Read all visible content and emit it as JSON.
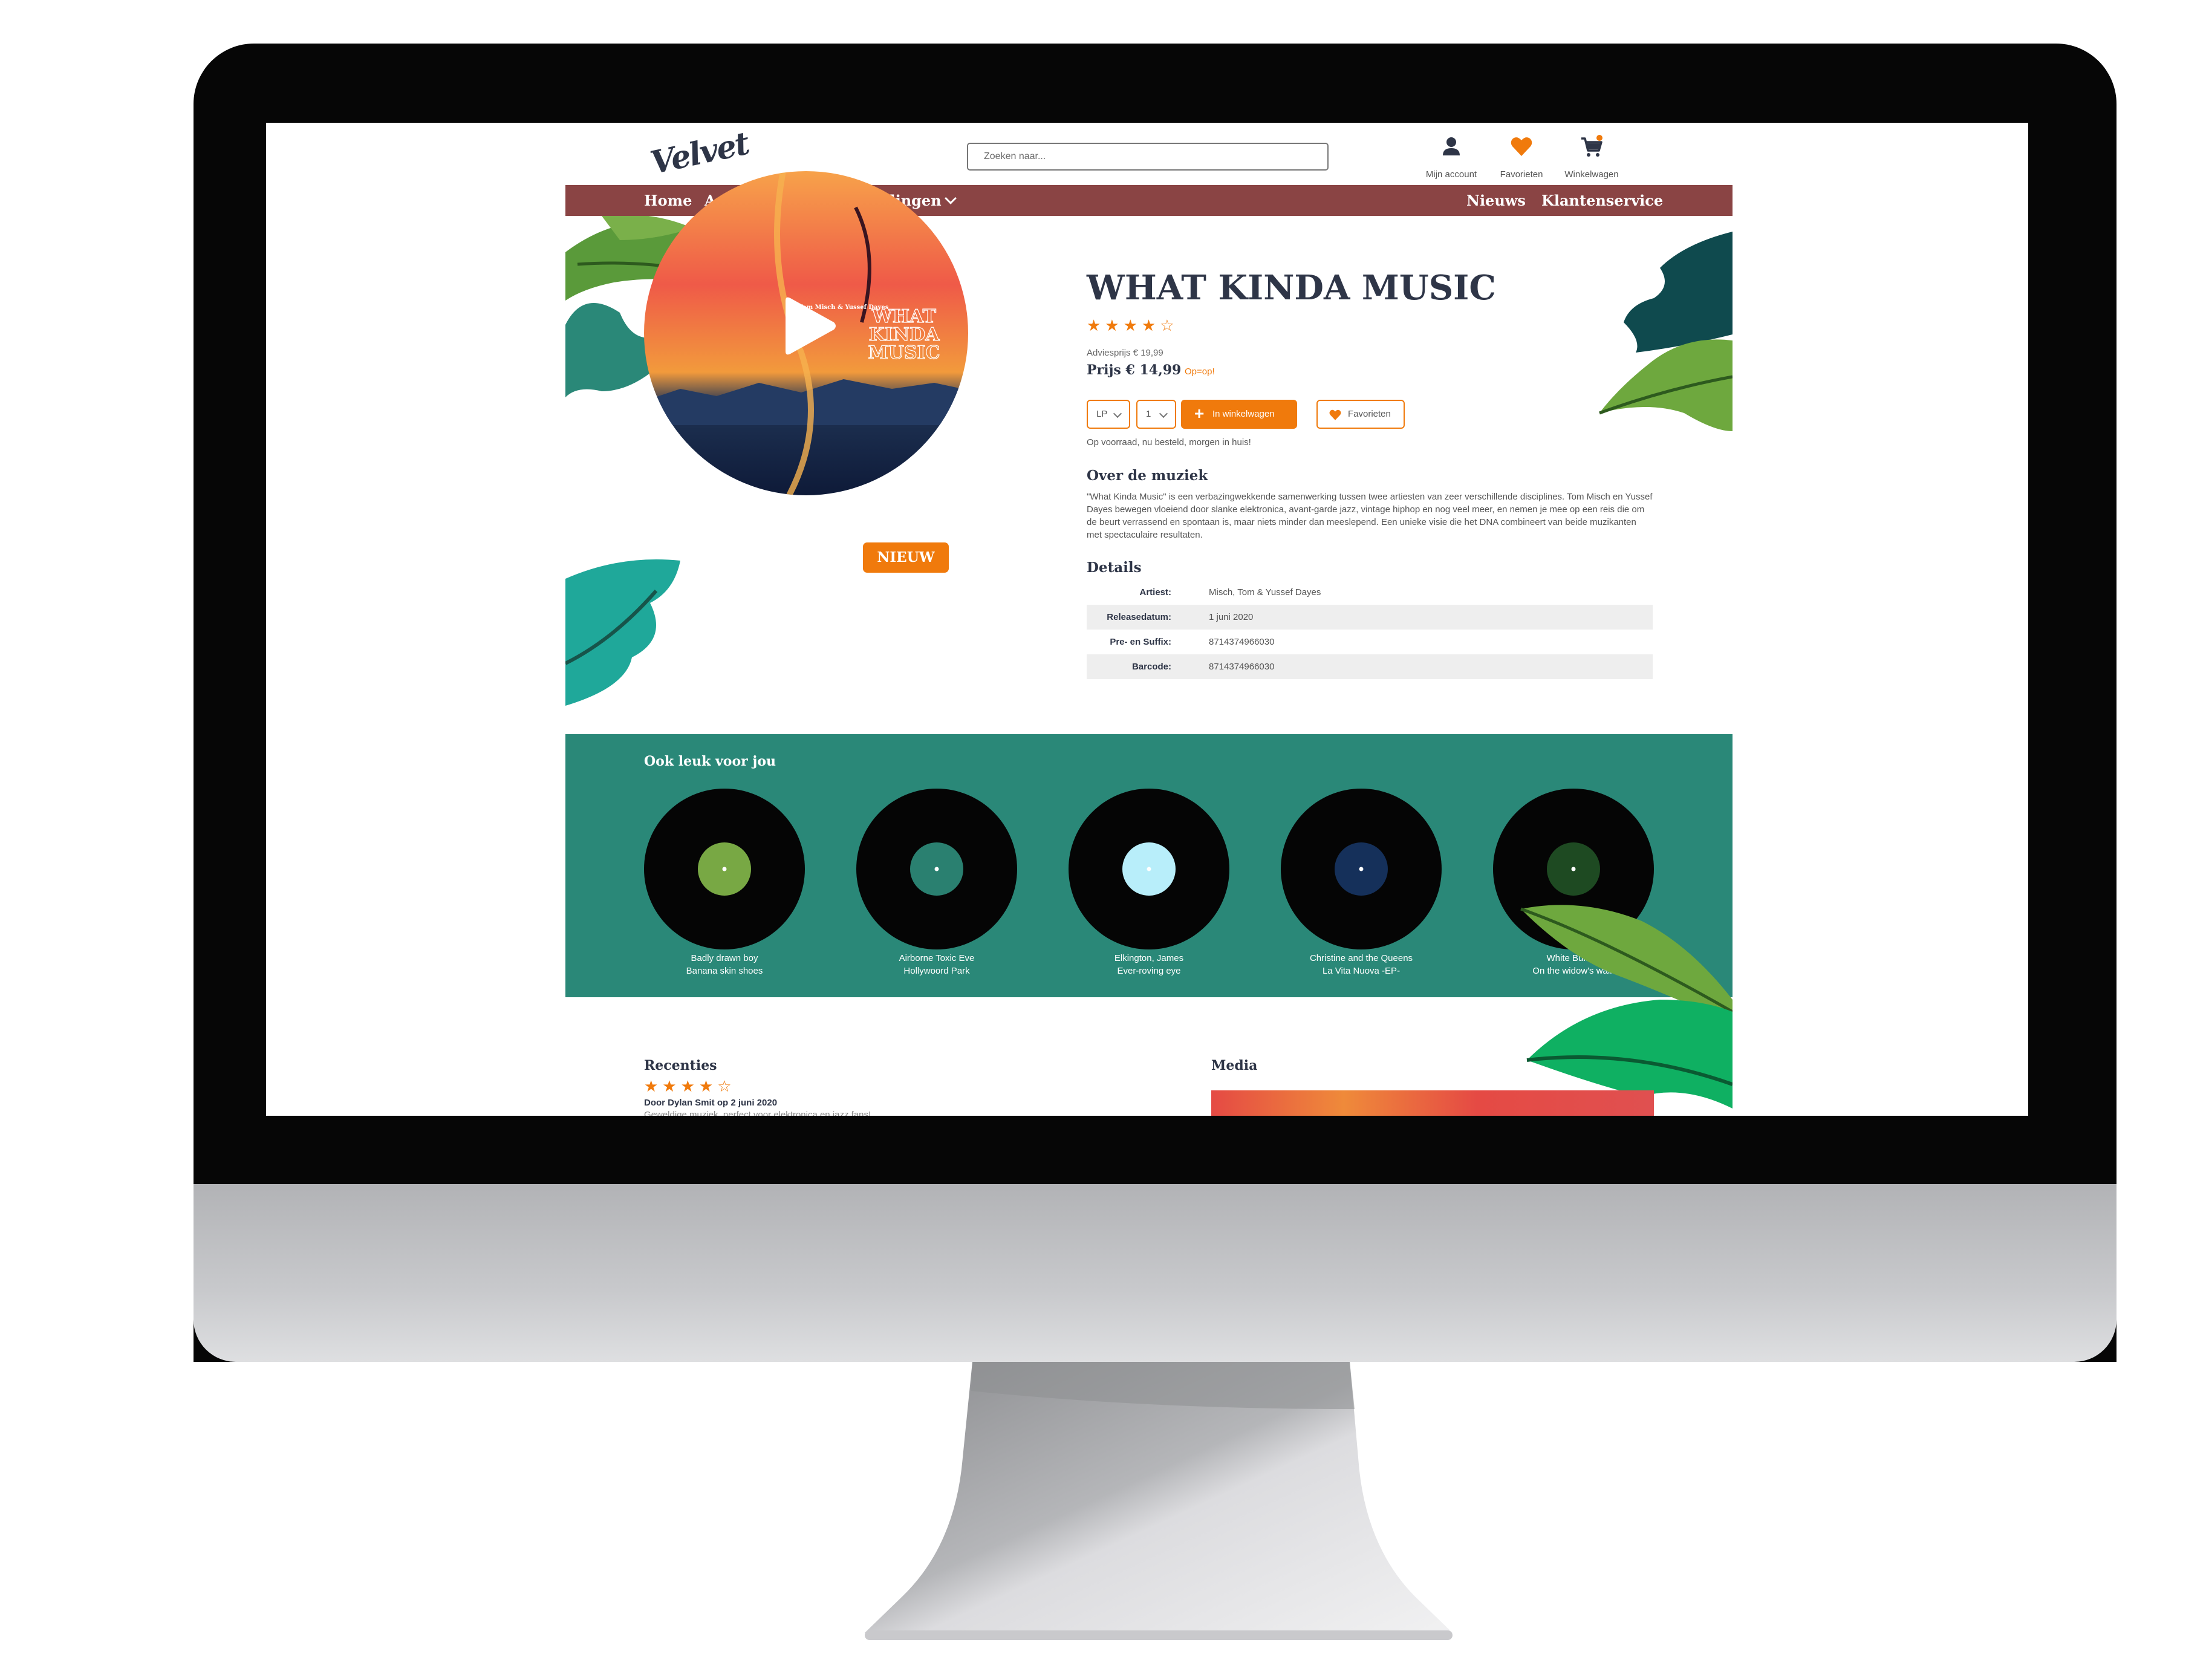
{
  "header": {
    "logo": "Velvet",
    "search_placeholder": "Zoeken naar...",
    "account_label": "Mijn account",
    "favorites_label": "Favorieten",
    "cart_label": "Winkelwagen"
  },
  "nav": {
    "home": "Home",
    "assortiment": "Assortiment",
    "aanbiedingen": "Aanbiedingen",
    "nieuws": "Nieuws",
    "klantenservice": "Klantenservice"
  },
  "product": {
    "title": "WHAT KINDA MUSIC",
    "rating_stars": "★★★★☆",
    "rating": 4,
    "adviesprijs": "Adviesprijs € 19,99",
    "prijs": "Prijs € 14,99",
    "sale_tag": "Op=op!",
    "format": "LP",
    "quantity": "1",
    "add_to_cart": "In winkelwagen",
    "favorite": "Favorieten",
    "stock": "Op voorraad, nu besteld, morgen in huis!",
    "badge": "NIEUW",
    "cover_artist": "Tom Misch & Yussef Dayes",
    "cover_title": "WHAT KINDA MUSIC"
  },
  "about": {
    "heading": "Over de muziek",
    "text": "\"What Kinda Music\" is een verbazingwekkende samenwerking tussen twee artiesten van zeer verschillende disciplines. Tom Misch en Yussef Dayes bewegen vloeiend door slanke elektronica, avant-garde jazz, vintage hiphop en nog veel meer, en nemen je mee op een reis die om de beurt verrassend en spontaan is, maar niets minder dan meeslepend. Een unieke visie die het DNA combineert van beide muzikanten met spectaculaire resultaten."
  },
  "details": {
    "heading": "Details",
    "rows": [
      {
        "key": "Artiest:",
        "value": "Misch, Tom & Yussef Dayes"
      },
      {
        "key": "Releasedatum:",
        "value": "1 juni 2020"
      },
      {
        "key": "Pre- en Suffix:",
        "value": "8714374966030"
      },
      {
        "key": "Barcode:",
        "value": "8714374966030"
      }
    ]
  },
  "recommend": {
    "heading": "Ook leuk voor jou",
    "items": [
      {
        "line1": "Badly drawn boy",
        "line2": "Banana skin shoes",
        "label_color": "#78a844"
      },
      {
        "line1": "Airborne Toxic Eve",
        "line2": "Hollywoord Park",
        "label_color": "#2a8070"
      },
      {
        "line1": "Elkington, James",
        "line2": "Ever-roving eye",
        "label_color": "#b8eefa"
      },
      {
        "line1": "Christine and the Queens",
        "line2": "La Vita Nuova -EP-",
        "label_color": "#15305a"
      },
      {
        "line1": "White Buffalo",
        "line2": "On the widow's walk",
        "label_color": "#1e4a22"
      }
    ]
  },
  "reviews": {
    "heading": "Recenties",
    "stars": "★★★★☆",
    "rating": 4,
    "author": "Door Dylan Smit op 2 juni 2020",
    "text": "Geweldige muziek, perfect voor elektronica en jazz fans!"
  },
  "media": {
    "heading": "Media"
  },
  "colors": {
    "nav_bg": "#8a4444",
    "accent": "#f07a0c",
    "recommend_bg": "#2a8878",
    "heading": "#2e3547"
  }
}
